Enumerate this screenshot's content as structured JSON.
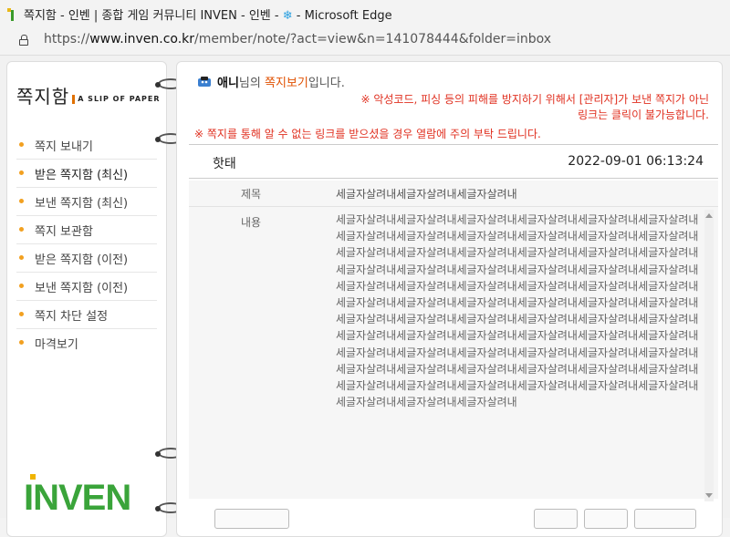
{
  "browser": {
    "title": "쪽지함 - 인벤 | 종합 게임 커뮤니티 INVEN - 인벤 - ❄ - Microsoft Edge",
    "title_prefix": "쪽지함 - 인벤 | 종합 게임 커뮤니티 INVEN - 인벤 - ",
    "title_suffix": " - Microsoft Edge",
    "title_emoji": "❄",
    "url_prefix": "https://",
    "url_host": "www.inven.co.kr",
    "url_path": "/member/note/?act=view&n=141078444&folder=inbox"
  },
  "sidebar": {
    "logo_text": "쪽지함",
    "logo_sub": "A SLIP OF PAPER",
    "items": [
      {
        "label": "쪽지 보내기"
      },
      {
        "label": "받은 쪽지함 (최신)"
      },
      {
        "label": "보낸 쪽지함 (최신)"
      },
      {
        "label": "쪽지 보관함"
      },
      {
        "label": "받은 쪽지함 (이전)"
      },
      {
        "label": "보낸 쪽지함 (이전)"
      },
      {
        "label": "쪽지 차단 설정"
      },
      {
        "label": "마격보기"
      }
    ],
    "brand": "INVEN"
  },
  "main": {
    "greet_name": "애니",
    "greet_mid": "님의 ",
    "greet_hl": "쪽지보기",
    "greet_end": "입니다.",
    "notice1": "※ 악성코드, 피싱 등의 피해를 방지하기 위해서 [관리자]가 보낸 쪽지가 아닌 링크는 클릭이 불가능합니다.",
    "notice2": "※ 쪽지를 통해 알 수 없는 링크를 받으셨을 경우 열람에 주의 부탁 드립니다.",
    "sender": "핫태",
    "date": "2022-09-01 06:13:24",
    "subject_label": "제목",
    "subject": "세글자살려내세글자살려내세글자살려내",
    "content_label": "내용",
    "content": "세글자살려내세글자살려내세글자살려내세글자살려내세글자살려내세글자살려내세글자살려내세글자살려내세글자살려내세글자살려내세글자살려내세글자살려내세글자살려내세글자살려내세글자살려내세글자살려내세글자살려내세글자살려내세글자살려내세글자살려내세글자살려내세글자살려내세글자살려내세글자살려내세글자살려내세글자살려내세글자살려내세글자살려내세글자살려내세글자살려내세글자살려내세글자살려내세글자살려내세글자살려내세글자살려내세글자살려내세글자살려내세글자살려내세글자살려내세글자살려내세글자살려내세글자살려내세글자살려내세글자살려내세글자살려내세글자살려내세글자살려내세글자살려내세글자살려내세글자살려내세글자살려내세글자살려내세글자살려내세글자살려내세글자살려내세글자살려내세글자살려내세글자살려내세글자살려내세글자살려내세글자살려내세글자살려내세글자살려내세글자살려내세글자살려내세글자살려내세글자살려내세글자살려내세글자살려내"
  }
}
